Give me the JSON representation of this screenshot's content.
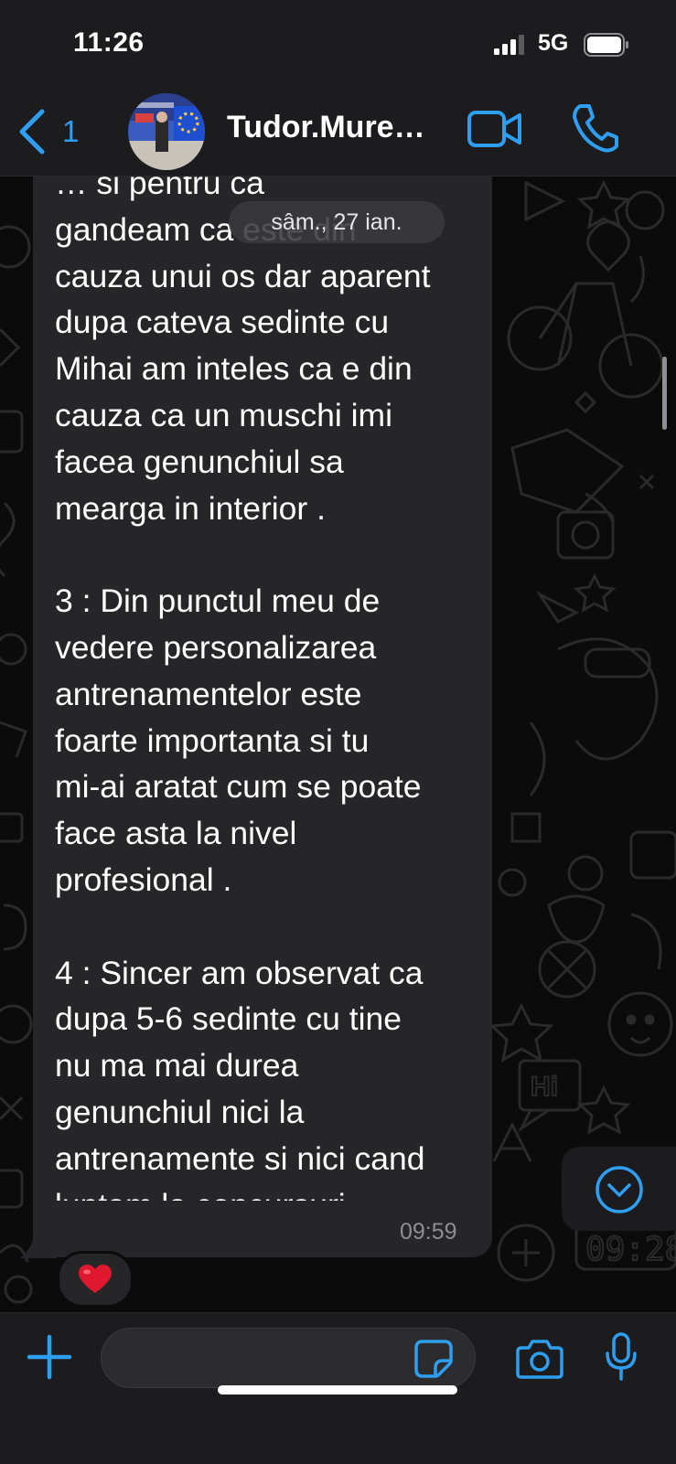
{
  "status_bar": {
    "time": "11:26",
    "network": "5G"
  },
  "header": {
    "back_count": "1",
    "contact_name": "Tudor.Mure…",
    "accent_color": "#2e9ef0"
  },
  "date_separator": "sâm., 27 ian.",
  "message": {
    "text": "… si pentru ca\ngandeam ca este din\ncauza unui os dar aparent\ndupa cateva sedinte cu\nMihai am inteles ca e din\ncauza ca un muschi imi\nfacea genunchiul sa\nmearga in interior .\n\n3 : Din punctul meu de\nvedere personalizarea\nantrenamentelor este\nfoarte importanta si tu\nmi-ai aratat cum se poate\nface asta la nivel\nprofesional .\n\n4 : Sincer am observat ca\ndupa 5-6 sedinte cu tine\nnu ma mai durea\ngenunchiul nici la\nantrenamente si nici cand\nluptam la concursuri .",
    "time": "09:59",
    "reaction": "heart-icon"
  },
  "composer": {
    "value": "",
    "placeholder": ""
  },
  "icons": {
    "back": "chevron-left-icon",
    "video": "video-camera-icon",
    "call": "phone-icon",
    "add": "plus-icon",
    "sticker": "sticker-icon",
    "camera": "camera-icon",
    "mic": "microphone-icon",
    "scroll_down": "chevron-down-circle-icon"
  }
}
